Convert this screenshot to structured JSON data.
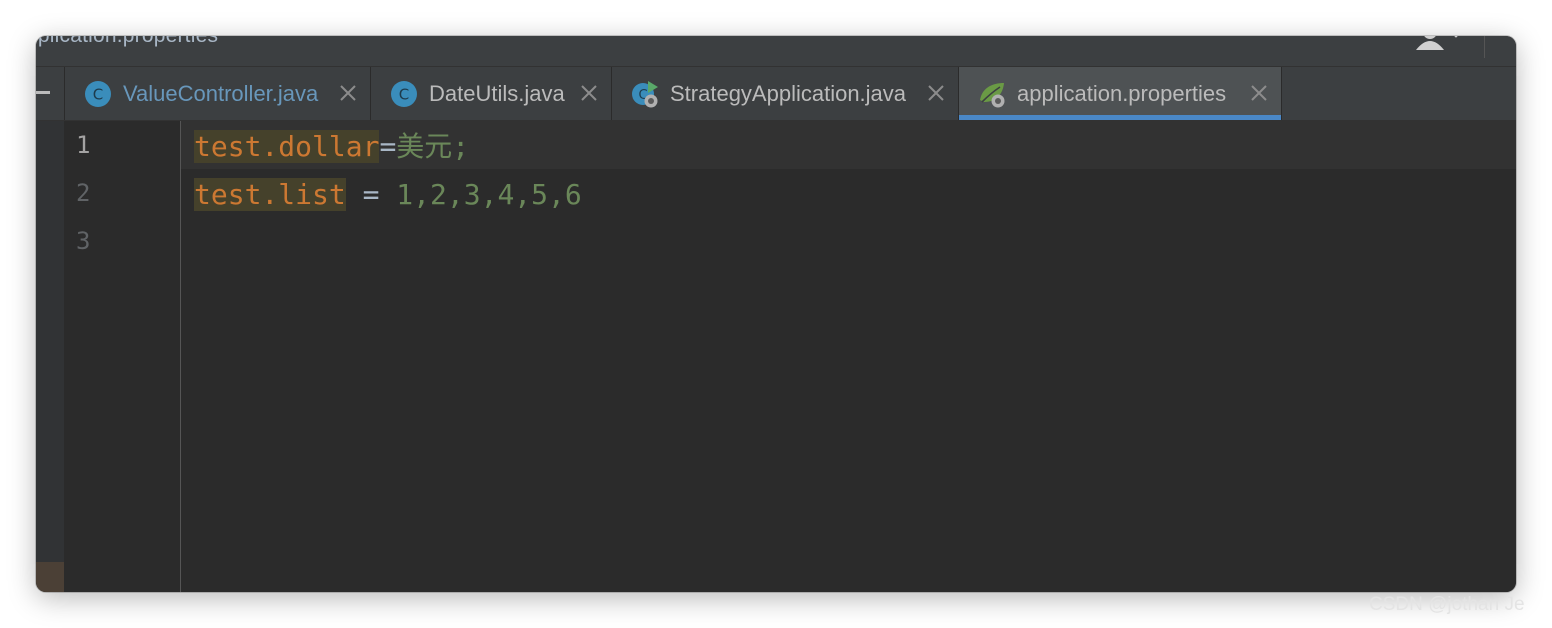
{
  "window": {
    "title": "pplication.properties"
  },
  "tabs": [
    {
      "label": "ValueController.java",
      "icon": "java-class-icon",
      "modified": true,
      "active": false
    },
    {
      "label": "DateUtils.java",
      "icon": "java-class-icon",
      "modified": false,
      "active": false
    },
    {
      "label": "StrategyApplication.java",
      "icon": "spring-boot-run-class-icon",
      "modified": false,
      "active": false
    },
    {
      "label": "application.properties",
      "icon": "spring-properties-icon",
      "modified": false,
      "active": true
    }
  ],
  "editor": {
    "line_numbers": [
      "1",
      "2",
      "3"
    ],
    "lines": [
      {
        "key": "test.dollar",
        "sep": "=",
        "value": "美元;"
      },
      {
        "key": "test.list",
        "sep": " = ",
        "value": "1,2,3,4,5,6"
      }
    ]
  },
  "colors": {
    "accent": "#4a88c7",
    "property_key": "#cc7832",
    "property_value": "#6a8759",
    "editor_bg": "#2b2b2b"
  },
  "watermark": "CSDN @jothan Je"
}
